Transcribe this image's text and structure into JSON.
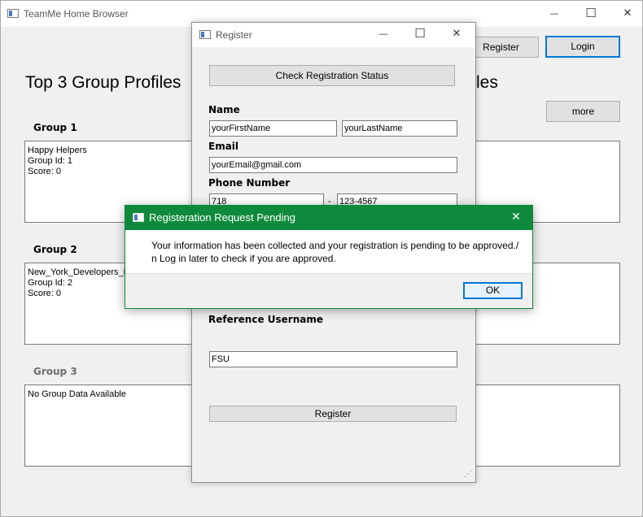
{
  "main_window": {
    "title": "TeamMe Home Browser",
    "minimize": "—",
    "maximize": "☐",
    "close": "✕",
    "register_label": "Register",
    "login_label": "Login",
    "heading_left": "Top 3 Group Profiles",
    "heading_right_fragment": "les",
    "more_label": "more",
    "groups": [
      {
        "title": "Group 1",
        "lines": [
          "Happy Helpers",
          "Group Id: 1",
          "Score: 0"
        ]
      },
      {
        "title": "Group 2",
        "lines": [
          "New_York_Developers_H",
          "Group Id: 2",
          "Score: 0"
        ]
      },
      {
        "title": "Group 3",
        "lines": [
          "No Group Data Available"
        ]
      }
    ]
  },
  "register_dialog": {
    "title": "Register",
    "minimize": "—",
    "maximize": "☐",
    "close": "✕",
    "check_status_label": "Check Registration Status",
    "name_label": "Name",
    "first_name": "yourFirstName",
    "last_name": "yourLastName",
    "email_label": "Email",
    "email": "yourEmail@gmail.com",
    "phone_label": "Phone Number",
    "phone_area": "718",
    "phone_dash": "-",
    "phone_number": "123-4567",
    "reference_label": "Reference Username",
    "reference_value": "FSU",
    "register_label": "Register",
    "resize_grip": "⋰"
  },
  "pending_dialog": {
    "title": "Registeration Request Pending",
    "close": "✕",
    "message_line1": "Your information has been collected and your registration is pending to be approved./",
    "message_line2": "n Log in later to check if you are approved.",
    "ok_label": "OK"
  },
  "colors": {
    "pending_titlebar": "#0f8a3c",
    "focus_border": "#0078d7"
  }
}
